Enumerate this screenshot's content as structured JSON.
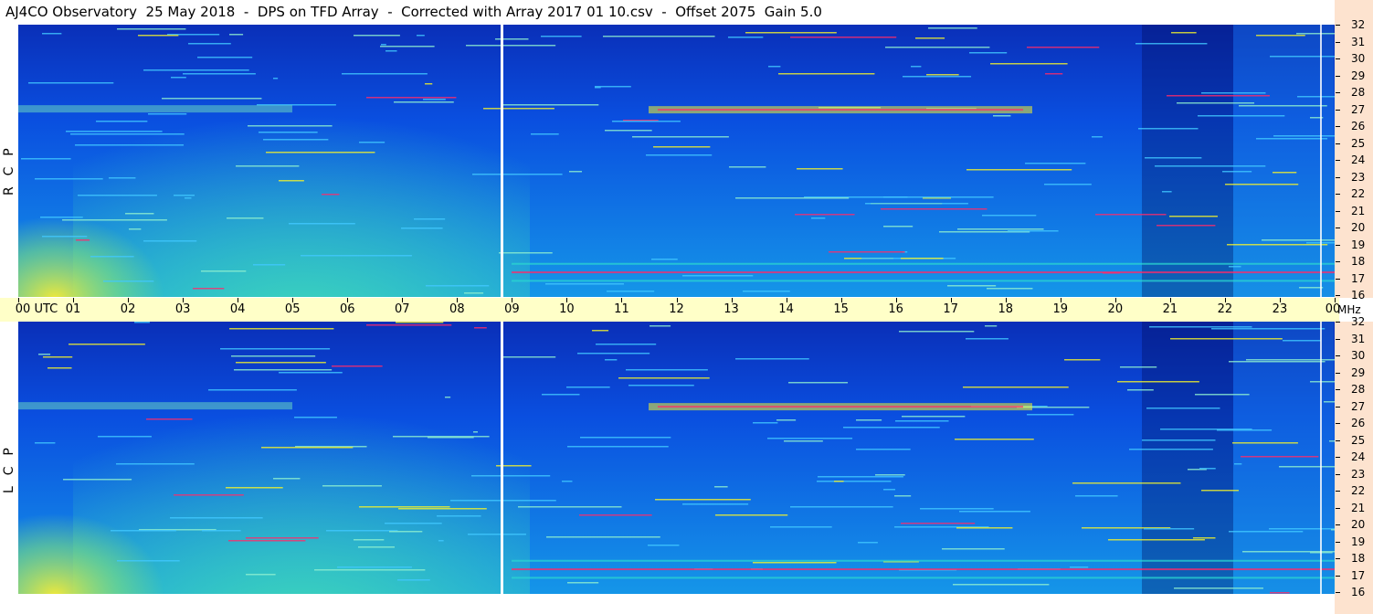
{
  "title": "AJ4CO Observatory  25 May 2018  -  DPS on TFD Array  -  Corrected with Array 2017 01 10.csv  -  Offset 2075  Gain 5.0",
  "panels": [
    {
      "id": "rcp",
      "polarization_label": "R  C  P"
    },
    {
      "id": "lcp",
      "polarization_label": "L  C  P"
    }
  ],
  "time_axis": {
    "labels": [
      "00 UTC",
      "01",
      "02",
      "03",
      "04",
      "05",
      "06",
      "07",
      "08",
      "09",
      "10",
      "11",
      "12",
      "13",
      "14",
      "15",
      "16",
      "17",
      "18",
      "19",
      "20",
      "21",
      "22",
      "23",
      "00"
    ],
    "unit": "MHz"
  },
  "freq_axis": {
    "labels": [
      "32",
      "31",
      "30",
      "29",
      "28",
      "27",
      "26",
      "25",
      "24",
      "23",
      "22",
      "21",
      "20",
      "19",
      "18",
      "17",
      "16"
    ]
  },
  "chart_data": {
    "type": "heatmap",
    "title": "AJ4CO Observatory  25 May 2018  -  DPS on TFD Array  -  Corrected with Array 2017 01 10.csv  -  Offset 2075  Gain 5.0",
    "x_range": [
      "00 UTC",
      "00"
    ],
    "y_range": [
      16,
      32
    ],
    "y_unit": "MHz",
    "colors": {
      "low": "#000a5a",
      "mid": "#0a4fe0",
      "high": "#2bd6d0",
      "peak": "#f4f22a",
      "max": "#ff2a6a"
    }
  }
}
